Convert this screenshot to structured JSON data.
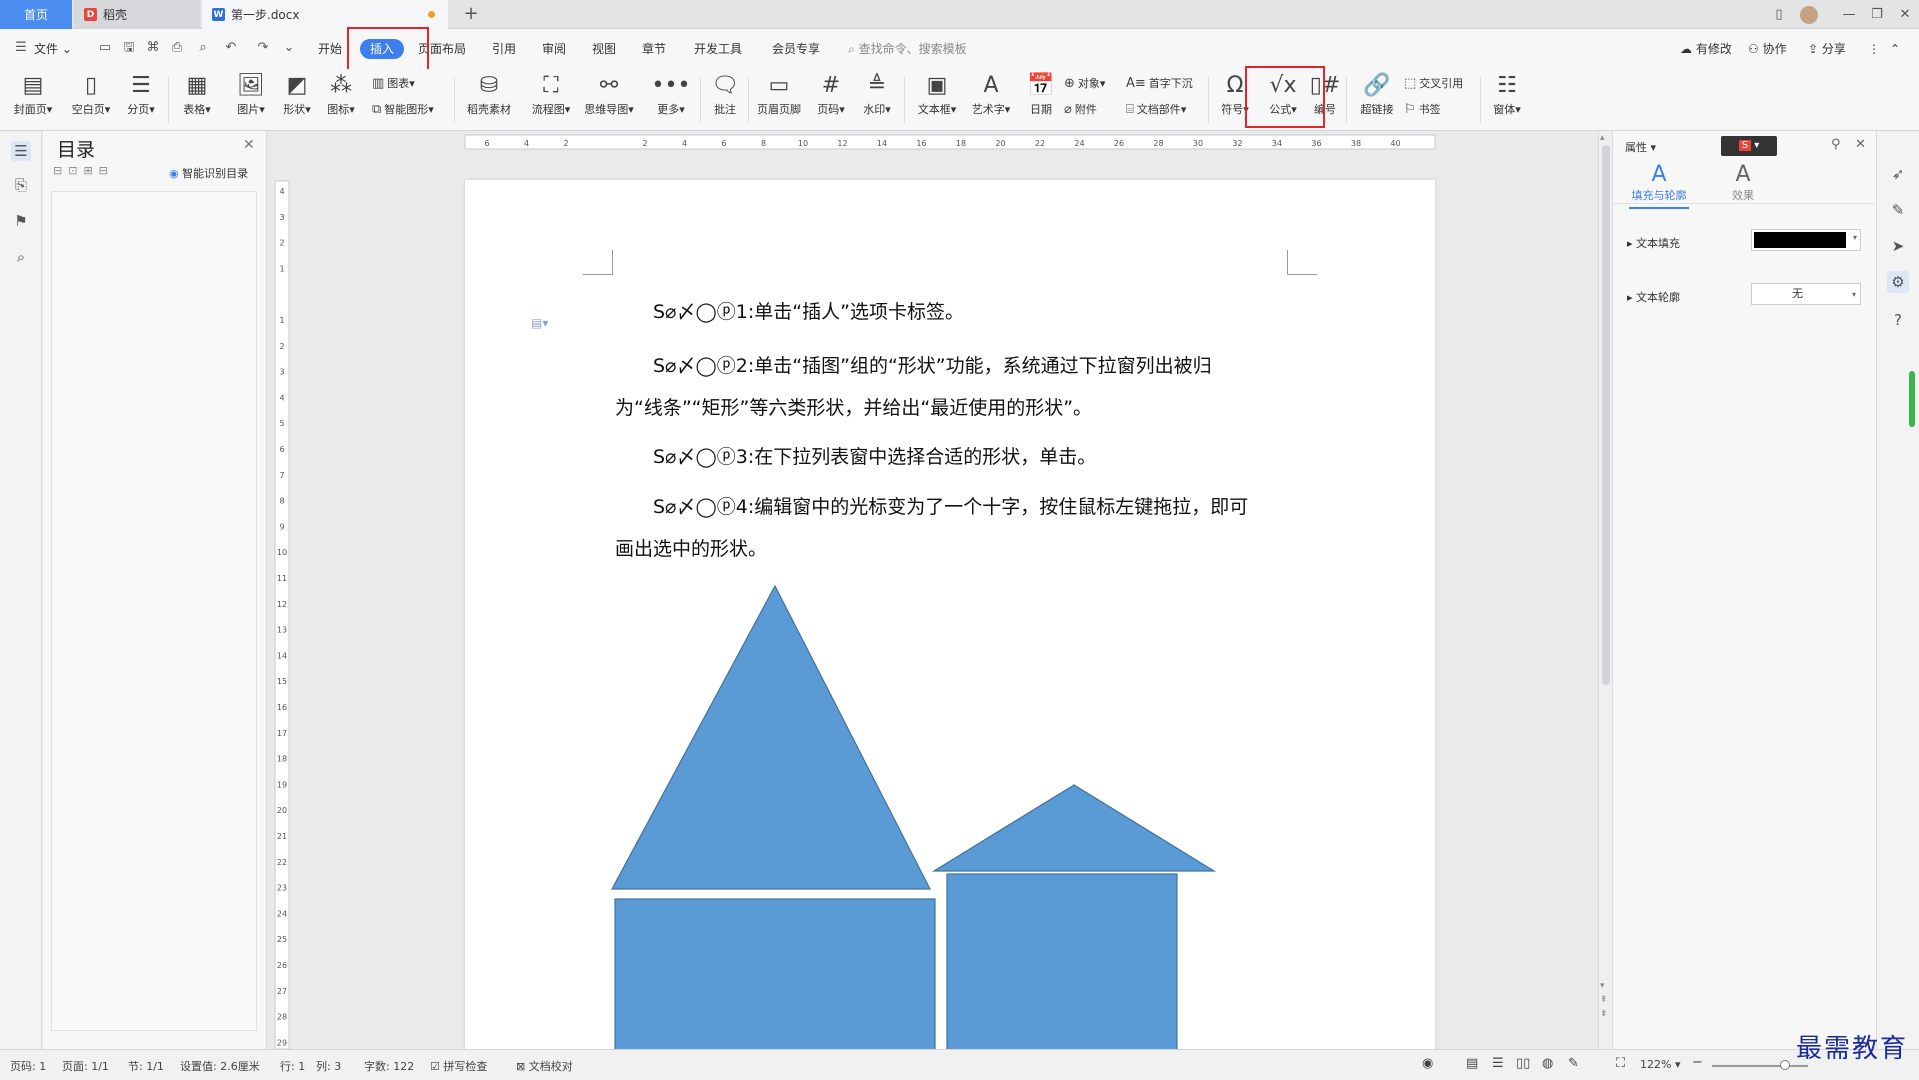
{
  "tabs": {
    "home": "首页",
    "daoke": "稻壳",
    "doc": "第一步.docx"
  },
  "menu": {
    "file": "文件",
    "items": [
      "开始",
      "插入",
      "页面布局",
      "引用",
      "审阅",
      "视图",
      "章节",
      "开发工具",
      "会员专享"
    ],
    "search_placeholder": "查找命令、搜索模板",
    "modified": "有修改",
    "collab": "协作",
    "share": "分享"
  },
  "ribbon": {
    "cover": "封面页",
    "blank": "空白页",
    "pagebreak": "分页",
    "table": "表格",
    "picture": "图片",
    "shape": "形状",
    "icon": "图标",
    "chart": "图表",
    "smartart": "智能图形",
    "daoke_material": "稻壳素材",
    "flowchart": "流程图",
    "mindmap": "思维导图",
    "more": "更多",
    "comment": "批注",
    "header_footer": "页眉页脚",
    "page_number": "页码",
    "watermark": "水印",
    "textbox": "文本框",
    "wordart": "艺术字",
    "date": "日期",
    "object": "对象",
    "attachment": "附件",
    "dropcap": "首字下沉",
    "docpart": "文档部件",
    "symbol": "符号",
    "equation": "公式",
    "numbering": "编号",
    "hyperlink": "超链接",
    "crossref": "交叉引用",
    "bookmark": "书签",
    "window": "窗体"
  },
  "toc": {
    "title": "目录",
    "smart": "智能识别目录"
  },
  "ruler": {
    "h_ticks": [
      "6",
      "4",
      "2",
      "",
      "2",
      "4",
      "6",
      "8",
      "10",
      "12",
      "14",
      "16",
      "18",
      "20",
      "22",
      "24",
      "26",
      "28",
      "30",
      "32",
      "34",
      "36",
      "38",
      "40"
    ],
    "v_ticks": [
      "4",
      "3",
      "2",
      "1",
      "",
      "1",
      "2",
      "3",
      "4",
      "5",
      "6",
      "7",
      "8",
      "9",
      "10",
      "11",
      "12",
      "13",
      "14",
      "15",
      "16",
      "17",
      "18",
      "19",
      "20",
      "21",
      "22",
      "23",
      "24",
      "25",
      "26",
      "27",
      "28",
      "29"
    ]
  },
  "document": {
    "step_prefix": "S⌀〆◯ⓟ",
    "steps": [
      {
        "num": "1:",
        "text": "单击“插人”选项卡标签。"
      },
      {
        "num": "2:",
        "text": "单击“插图”组的“形状”功能，系统通过下拉窗列出被归",
        "cont": "为“线条”“矩形”等六类形状，并给出“最近使用的形状”。"
      },
      {
        "num": "3:",
        "text": "在下拉列表窗中选择合适的形状，单击。"
      },
      {
        "num": "4:",
        "text": "编辑窗中的光标变为了一个十字，按住鼠标左键拖拉，即可",
        "cont": "画出选中的形状。"
      }
    ],
    "shape_color": "#5b9bd5",
    "shape_stroke": "#41719c"
  },
  "props": {
    "title": "属性",
    "tab_fill": "填充与轮廓",
    "tab_effect": "效果",
    "text_fill": "文本填充",
    "text_outline": "文本轮廓",
    "outline_value": "无",
    "fill_color": "#000000"
  },
  "status": {
    "page": "页码: 1",
    "pages": "页面: 1/1",
    "section": "节: 1/1",
    "setting": "设置值: 2.6厘米",
    "row": "行: 1",
    "col": "列: 3",
    "words": "字数: 122",
    "spell": "拼写检查",
    "proof": "文档校对",
    "zoom": "122%"
  },
  "watermark_text": "最需教育",
  "accent": "#3d7ef0",
  "highlight": "#e0252c"
}
